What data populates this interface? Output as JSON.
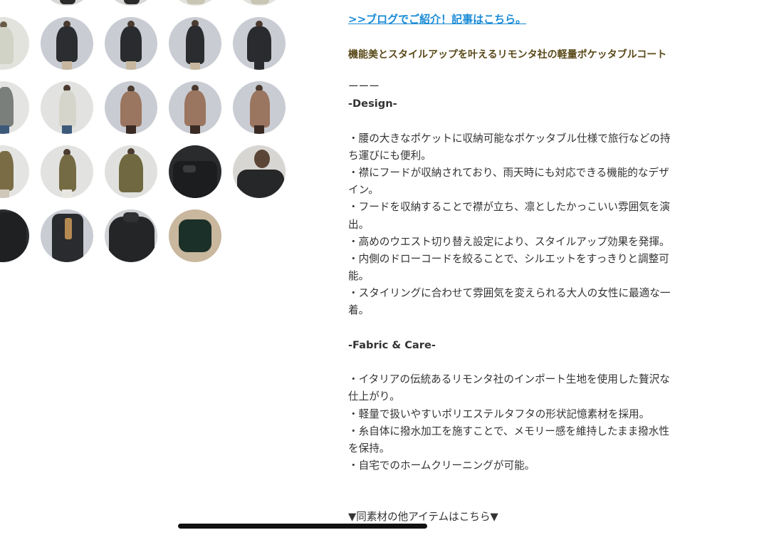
{
  "link": ">>ブログでご紹介！記事はこちら。",
  "headline": "機能美とスタイルアップを叶えるリモンタ社の軽量ポケッタブルコート",
  "divider": "ーーー",
  "design_heading": "-Design-",
  "design_lines": [
    "・腰の大きなポケットに収納可能なポケッタブル仕様で旅行などの持",
    "ち運びにも便利。",
    "・襟にフードが収納されており、雨天時にも対応できる機能的なデザ",
    "イン。",
    "・フードを収納することで襟が立ち、凛としたかっこいい雰囲気を演",
    "出。",
    "・高めのウエスト切り替え設定により、スタイルアップ効果を発揮。",
    "・内側のドローコードを絞ることで、シルエットをすっきりと調整可",
    "能。",
    "・スタイリングに合わせて雰囲気を変えられる大人の女性に最適な一",
    "着。"
  ],
  "fabric_heading": "-Fabric & Care-",
  "fabric_lines": [
    "・イタリアの伝統あるリモンタ社のインポート生地を使用した贅沢な",
    "仕上がり。",
    "・軽量で扱いやすいポリエステルタフタの形状記憶素材を採用。",
    "・糸自体に撥水加工を施すことで、メモリー感を維持したまま撥水性",
    "を保持。",
    "・自宅でのホームクリーニングが可能。"
  ],
  "bottom_text": "▼同素材の他アイテムはこちら▼",
  "colors": {
    "link": "#1a8bd6",
    "headline": "#5a4a1a",
    "body_text": "#333333"
  }
}
